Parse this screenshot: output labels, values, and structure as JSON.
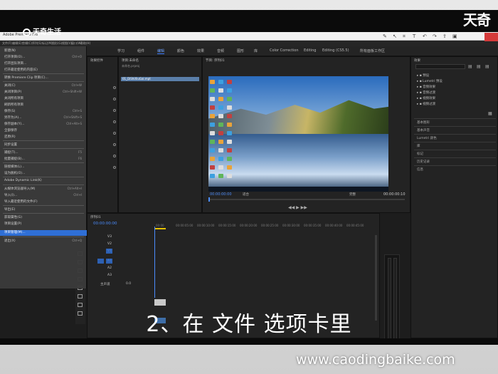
{
  "overlay": {
    "logo_text": "天奇生活",
    "brand_text": "天奇",
    "subtitle": "2、在 文件 选项卡里",
    "watermark": "www.caodingbaike.com"
  },
  "window": {
    "title": "Adobe Premiere Pro"
  },
  "menubar": {
    "items": [
      "文件(F)",
      "编辑(E)",
      "剪辑(C)",
      "序列(S)",
      "标记(M)",
      "图形(G)",
      "视图(V)",
      "窗口(W)",
      "帮助(H)"
    ]
  },
  "workspaces": {
    "tabs": [
      "学习",
      "组件",
      "编辑",
      "颜色",
      "效果",
      "音频",
      "图形",
      "库",
      "Color Correction",
      "Editing",
      "Editing (CS5.5)",
      "所有面板工作区"
    ],
    "active_index": 2
  },
  "file_menu": {
    "items": [
      {
        "label": "新建(N)",
        "shortcut": ""
      },
      {
        "label": "打开项目(O)...",
        "shortcut": "Ctrl+O"
      },
      {
        "label": "打开团队项目...",
        "shortcut": ""
      },
      {
        "label": "打开最近使用的内容(E)",
        "shortcut": ""
      },
      {
        "label": "转换 Premiere Clip 项目(C)...",
        "shortcut": ""
      },
      {
        "label": "关闭(C)",
        "shortcut": "Ctrl+W"
      },
      {
        "label": "关闭项目(P)",
        "shortcut": "Ctrl+Shift+W"
      },
      {
        "label": "关闭所有项目",
        "shortcut": ""
      },
      {
        "label": "刷新所有项目",
        "shortcut": ""
      },
      {
        "label": "保存(S)",
        "shortcut": "Ctrl+S"
      },
      {
        "label": "另存为(A)...",
        "shortcut": "Ctrl+Shift+S"
      },
      {
        "label": "保存副本(Y)...",
        "shortcut": "Ctrl+Alt+S"
      },
      {
        "label": "全部保存",
        "shortcut": ""
      },
      {
        "label": "还原(R)",
        "shortcut": ""
      },
      {
        "label": "同步设置",
        "shortcut": ""
      },
      {
        "label": "捕捉(T)...",
        "shortcut": "F5"
      },
      {
        "label": "批量捕捉(B)...",
        "shortcut": "F6"
      },
      {
        "label": "链接媒体(L)...",
        "shortcut": ""
      },
      {
        "label": "设为脱机(O)...",
        "shortcut": ""
      },
      {
        "label": "Adobe Dynamic Link(K)",
        "shortcut": ""
      },
      {
        "label": "从媒体浏览器导入(M)",
        "shortcut": "Ctrl+Alt+I"
      },
      {
        "label": "导入(I)...",
        "shortcut": "Ctrl+I"
      },
      {
        "label": "导入最近使用的文件(F)",
        "shortcut": ""
      },
      {
        "label": "导出(E)",
        "shortcut": ""
      },
      {
        "label": "获取属性(G)",
        "shortcut": ""
      },
      {
        "label": "项目设置(P)",
        "shortcut": ""
      },
      {
        "label": "项目管理(M)...",
        "shortcut": ""
      },
      {
        "label": "退出(X)",
        "shortcut": "Ctrl+Q"
      }
    ],
    "highlighted_index": 26
  },
  "source_panel": {
    "title": "源:(无剪辑)",
    "tab": "效果控件"
  },
  "project_panel": {
    "title": "项目:未命名",
    "file": "未命名.prproj",
    "clip": "01_DiShiXiuGai.mpt"
  },
  "program_monitor": {
    "title": "节目: 序列01",
    "timecode_in": "00:00:00:00",
    "timecode_out": "00:00:00:10",
    "fit": "适合",
    "quality": "完整"
  },
  "timeline": {
    "title": "序列01",
    "timecode": "00:00:00:00",
    "ruler": [
      "00:00",
      "00:00:05:00",
      "00:00:10:00",
      "00:00:15:00",
      "00:00:20:00",
      "00:00:25:00",
      "00:00:30:00",
      "00:00:35:00",
      "00:00:40:00",
      "00:00:45:00",
      "00:00:50:00"
    ],
    "tracks": [
      "V3",
      "V2",
      "V1",
      "A1",
      "A2",
      "A3"
    ],
    "master": "主声道",
    "master_value": "0.0"
  },
  "effects_panel": {
    "title": "效果",
    "folders": [
      "预设",
      "Lumetri 预设",
      "音频效果",
      "音频过渡",
      "视频效果",
      "视频过渡"
    ],
    "sections": [
      "基本图形",
      "基本声音",
      "Lumetri 颜色",
      "库",
      "标记",
      "历史记录",
      "信息"
    ]
  },
  "colors": {
    "accent": "#2f6fd6",
    "panel_bg": "#232323",
    "highlight_blue": "#3a7bff"
  }
}
